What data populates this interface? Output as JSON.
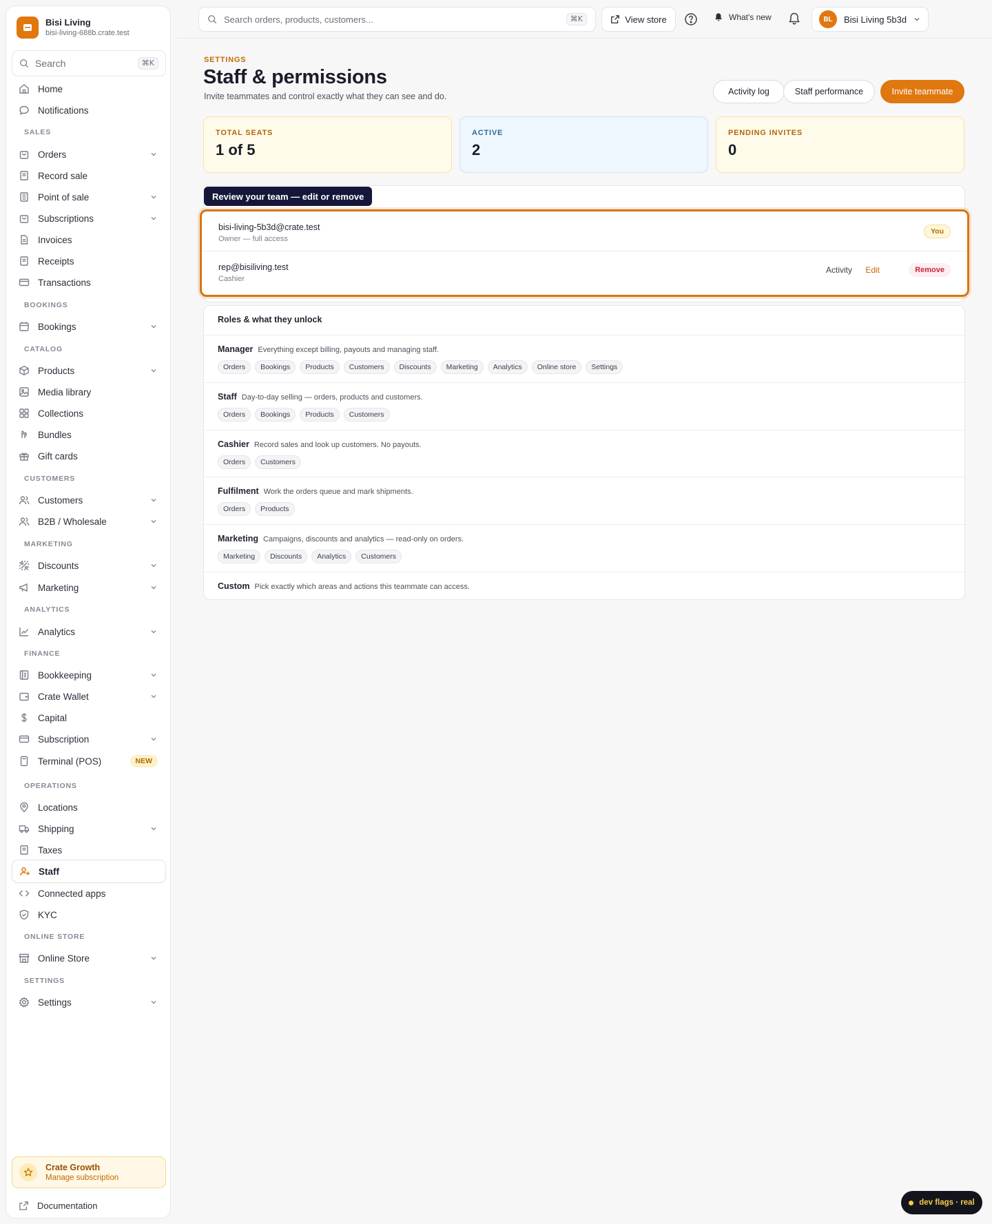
{
  "brand": {
    "name": "Bisi Living",
    "domain": "bisi-living-688b.crate.test"
  },
  "sidebar": {
    "search_placeholder": "Search",
    "search_shortcut": "⌘K",
    "items": {
      "home": "Home",
      "notifications": "Notifications",
      "orders": "Orders",
      "record_sale": "Record sale",
      "point_of_sale": "Point of sale",
      "subscriptions": "Subscriptions",
      "invoices": "Invoices",
      "receipts": "Receipts",
      "transactions": "Transactions",
      "bookings": "Bookings",
      "products": "Products",
      "media_library": "Media library",
      "collections": "Collections",
      "bundles": "Bundles",
      "gift_cards": "Gift cards",
      "customers": "Customers",
      "b2b": "B2B / Wholesale",
      "discounts": "Discounts",
      "marketing": "Marketing",
      "analytics": "Analytics",
      "bookkeeping": "Bookkeeping",
      "crate_wallet": "Crate Wallet",
      "capital": "Capital",
      "subscription": "Subscription",
      "terminal": "Terminal (POS)",
      "locations": "Locations",
      "shipping": "Shipping",
      "taxes": "Taxes",
      "staff": "Staff",
      "connected_apps": "Connected apps",
      "kyc": "KYC",
      "online_store": "Online Store",
      "settings": "Settings"
    },
    "sections": {
      "sales": "SALES",
      "bookings": "BOOKINGS",
      "catalog": "CATALOG",
      "customers": "CUSTOMERS",
      "marketing": "MARKETING",
      "analytics": "ANALYTICS",
      "finance": "FINANCE",
      "operations": "OPERATIONS",
      "online_store": "ONLINE STORE",
      "settings": "SETTINGS"
    },
    "new_badge": "NEW",
    "growth": {
      "title": "Crate Growth",
      "subtitle": "Manage subscription"
    },
    "documentation": "Documentation"
  },
  "topbar": {
    "search_placeholder": "Search orders, products, customers...",
    "search_shortcut": "⌘K",
    "view_store": "View store",
    "whats_new": "What's new",
    "account_initials": "BL",
    "account_name": "Bisi Living 5b3d"
  },
  "page": {
    "eyebrow": "SETTINGS",
    "title": "Staff & permissions",
    "subtitle": "Invite teammates and control exactly what they can see and do.",
    "buttons": {
      "activity_log": "Activity log",
      "staff_performance": "Staff performance",
      "invite": "Invite teammate"
    }
  },
  "stats": {
    "total_seats": {
      "label": "TOTAL SEATS",
      "value": "1 of 5"
    },
    "active": {
      "label": "ACTIVE",
      "value": "2"
    },
    "pending": {
      "label": "PENDING INVITES",
      "value": "0"
    }
  },
  "team": {
    "callout": "Review your team — edit or remove",
    "members": [
      {
        "email": "bisi-living-5b3d@crate.test",
        "role": "Owner — full access",
        "badge": "You"
      },
      {
        "email": "rep@bisiliving.test",
        "role": "Cashier",
        "activity": "Activity",
        "edit": "Edit",
        "remove": "Remove"
      }
    ]
  },
  "roles": {
    "heading": "Roles & what they unlock",
    "items": [
      {
        "name": "Manager",
        "desc": "Everything except billing, payouts and managing staff.",
        "chips": [
          "Orders",
          "Bookings",
          "Products",
          "Customers",
          "Discounts",
          "Marketing",
          "Analytics",
          "Online store",
          "Settings"
        ]
      },
      {
        "name": "Staff",
        "desc": "Day-to-day selling — orders, products and customers.",
        "chips": [
          "Orders",
          "Bookings",
          "Products",
          "Customers"
        ]
      },
      {
        "name": "Cashier",
        "desc": "Record sales and look up customers. No payouts.",
        "chips": [
          "Orders",
          "Customers"
        ]
      },
      {
        "name": "Fulfilment",
        "desc": "Work the orders queue and mark shipments.",
        "chips": [
          "Orders",
          "Products"
        ]
      },
      {
        "name": "Marketing",
        "desc": "Campaigns, discounts and analytics — read-only on orders.",
        "chips": [
          "Marketing",
          "Discounts",
          "Analytics",
          "Customers"
        ]
      },
      {
        "name": "Custom",
        "desc": "Pick exactly which areas and actions this teammate can access.",
        "chips": []
      }
    ]
  },
  "dev_flags": "dev flags · real",
  "colors": {
    "accent": "#e0770f",
    "callout_bg": "#15173a",
    "remove": "#c5283d"
  }
}
